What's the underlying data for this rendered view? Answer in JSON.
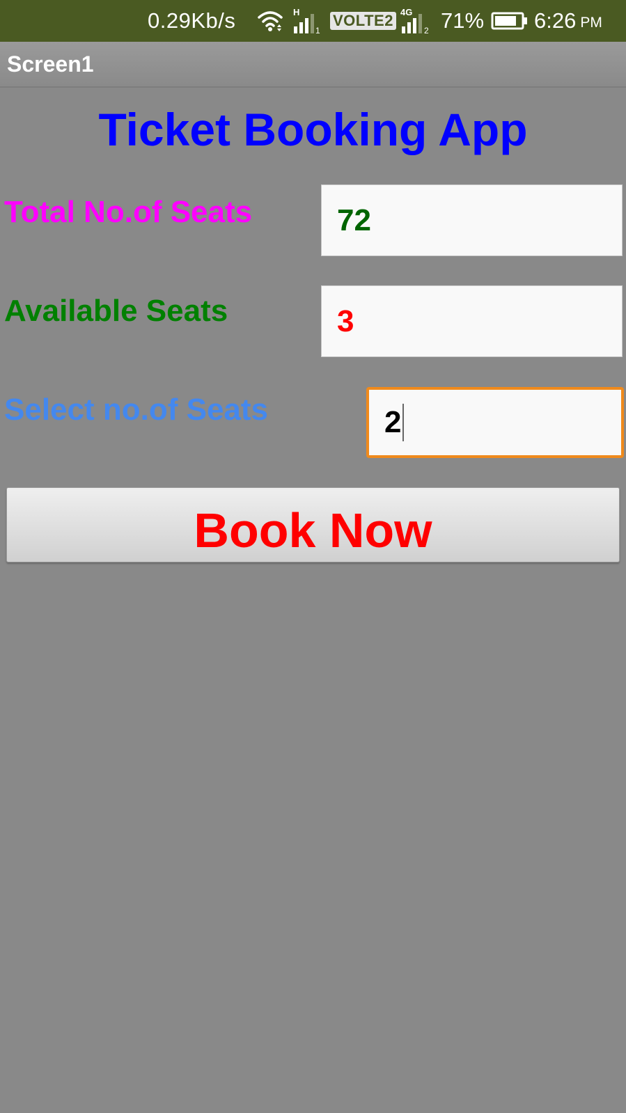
{
  "status_bar": {
    "network_speed": "0.29Kb/s",
    "sim1_network": "H",
    "sim1_index": "1",
    "volte": "VOLTE2",
    "sim2_network": "4G",
    "sim2_index": "2",
    "battery_percent": "71%",
    "time": "6:26",
    "ampm": "PM",
    "icons": [
      "wifi-icon",
      "signal-icon",
      "signal-icon",
      "battery-icon"
    ]
  },
  "title_bar": {
    "title": "Screen1"
  },
  "main": {
    "app_title": "Ticket Booking App",
    "total_seats": {
      "label": "Total No.of Seats",
      "value": "72"
    },
    "available_seats": {
      "label": "Available Seats",
      "value": "3"
    },
    "select_seats": {
      "label": "Select no.of Seats",
      "value": "2"
    },
    "book_button_label": "Book Now"
  },
  "colors": {
    "status_bar_bg": "#4a5a22",
    "background": "#898989",
    "app_title": "#0000ff",
    "total_label": "#ff00ff",
    "available_label": "#008000",
    "select_label": "#4488ee",
    "total_value": "#006400",
    "available_value": "#ff0000",
    "focus_border": "#f08a1c",
    "book_button_text": "#ff0000"
  }
}
